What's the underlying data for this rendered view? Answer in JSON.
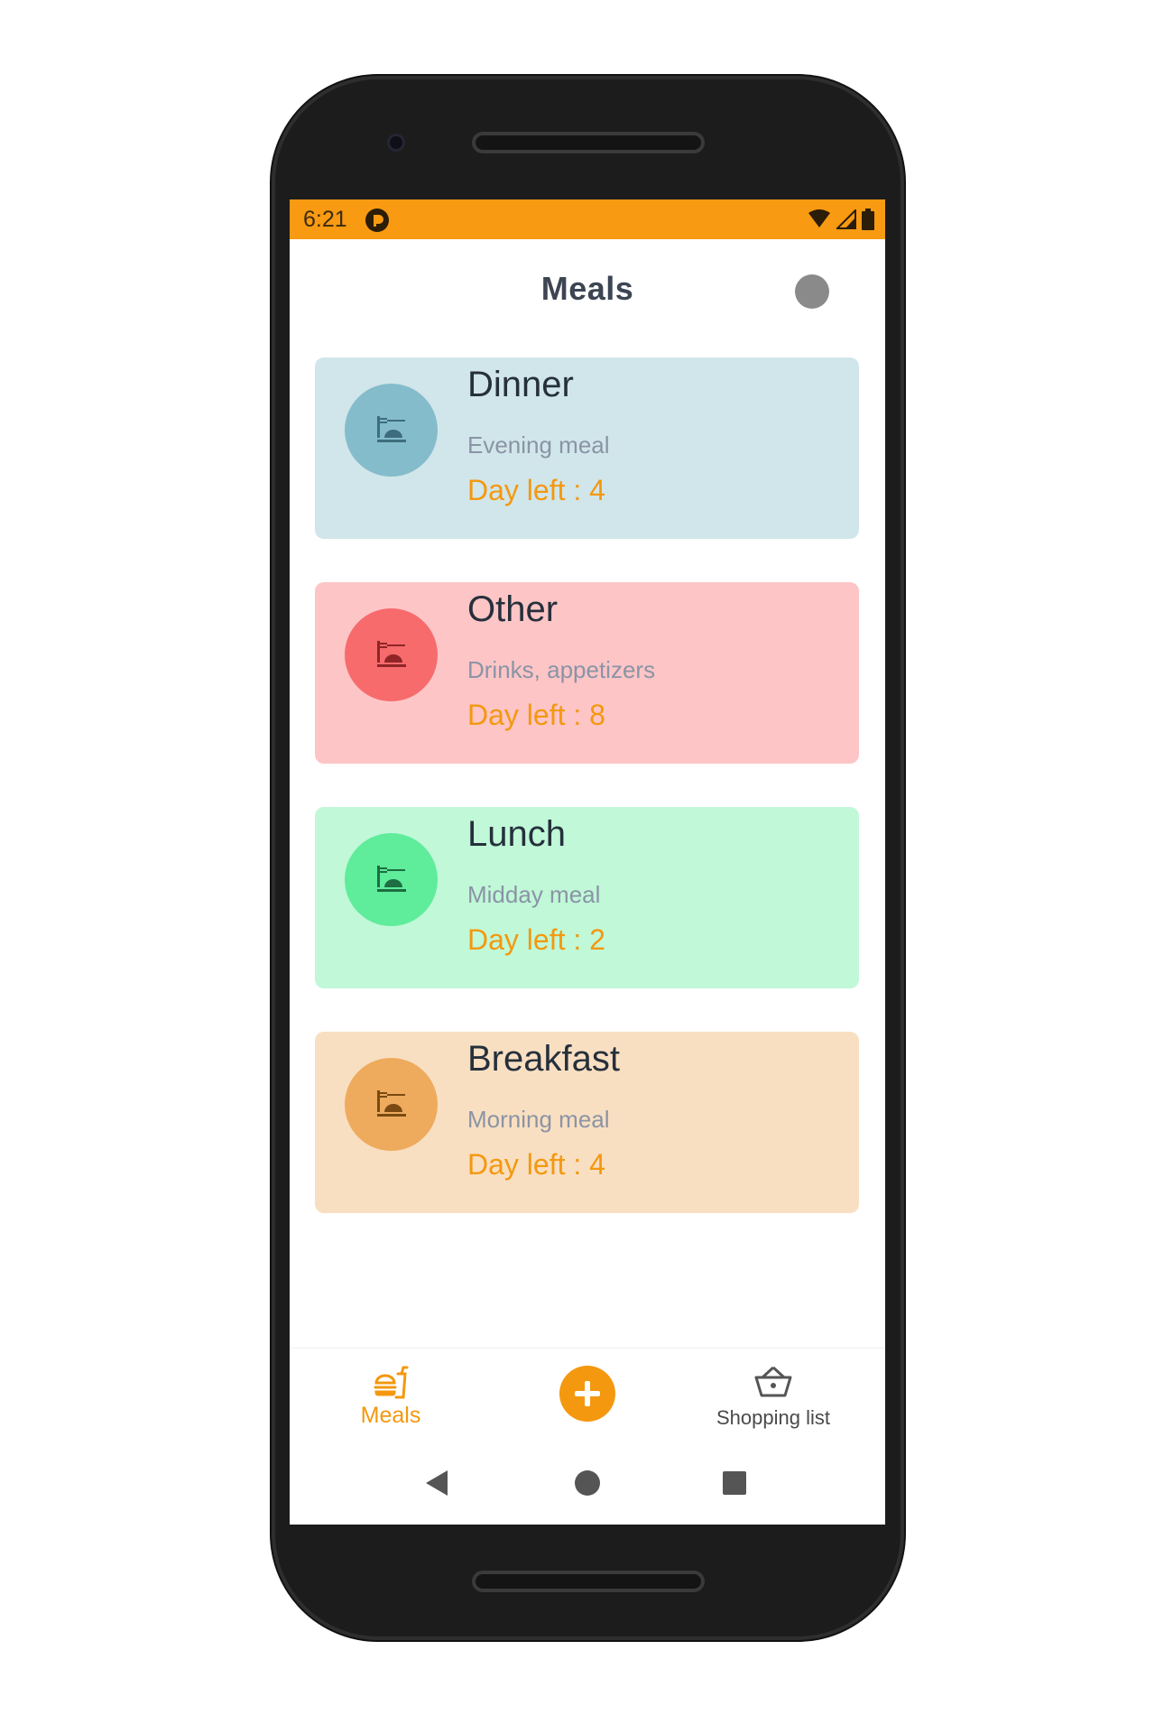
{
  "status_bar": {
    "time": "6:21",
    "color": "#f89a12"
  },
  "app_bar": {
    "title": "Meals"
  },
  "meals": [
    {
      "name": "Dinner",
      "description": "Evening meal",
      "days_left": "Day left : 4",
      "card_color": "#d1e6ea",
      "circle_color": "#85bccb",
      "icon_color": "#3e6e7d",
      "icon": "dish-icon"
    },
    {
      "name": "Other",
      "description": "Drinks, appetizers",
      "days_left": "Day left : 8",
      "card_color": "#fdc5c6",
      "circle_color": "#f76b6d",
      "icon_color": "#8f2527",
      "icon": "dish-icon"
    },
    {
      "name": "Lunch",
      "description": "Midday meal",
      "days_left": "Day left : 2",
      "card_color": "#c0f8d8",
      "circle_color": "#5fec9b",
      "icon_color": "#1d6e42",
      "icon": "dish-icon"
    },
    {
      "name": "Breakfast",
      "description": "Morning meal",
      "days_left": "Day left : 4",
      "card_color": "#f9dfc1",
      "circle_color": "#eeab5e",
      "icon_color": "#7a4a12",
      "icon": "dish-icon"
    }
  ],
  "bottom_nav": {
    "meals_label": "Meals",
    "shopping_label": "Shopping list",
    "accent_color": "#f4980f",
    "fab_icon": "plus-icon"
  }
}
